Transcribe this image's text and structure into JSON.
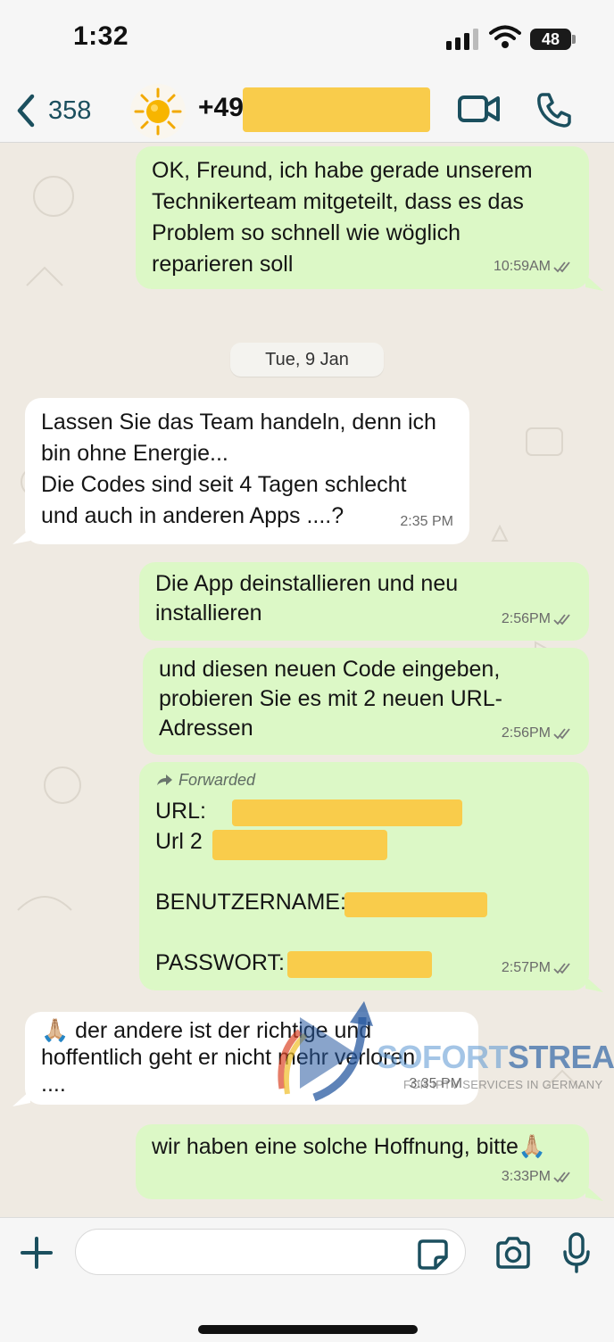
{
  "status_bar": {
    "time": "1:32",
    "battery": "48"
  },
  "header": {
    "back_count": "358",
    "contact_name": "+49"
  },
  "messages": [
    {
      "direction": "out",
      "text": "OK, Freund, ich habe gerade unserem\nTechnikerteam mitgeteilt, dass es das\nProblem so schnell wie wöglich\nreparieren soll",
      "time": "10:59AM"
    },
    {
      "direction": "in",
      "text": "Lassen Sie das Team handeln, denn ich\nbin ohne Energie...\nDie Codes sind seit 4 Tagen schlecht\nund auch in anderen Apps ....?",
      "time": "2:35 PM"
    },
    {
      "direction": "out",
      "text": "Die App deinstallieren und neu\ninstallieren",
      "time": "2:56PM"
    },
    {
      "direction": "out",
      "text": "und diesen neuen Code eingeben,\nprobieren Sie es mit 2 neuen URL-\nAdressen",
      "time": "2:56PM"
    },
    {
      "direction": "out",
      "forwarded_label": "Forwarded",
      "lines": {
        "url": "URL:",
        "url2": "Url 2",
        "user": "BENUTZERNAME:",
        "pass": "PASSWORT:"
      },
      "time": "2:57PM"
    },
    {
      "direction": "in",
      "text": "🙏🏼 der andere ist der richtige und\nhoffentlich geht er nicht mehr verloren\n....",
      "time": "3:35 PM"
    },
    {
      "direction": "out",
      "text": "wir haben eine solche Hoffnung, bitte🙏🏼",
      "time": "3:33PM"
    }
  ],
  "date_separator": "Tue, 9 Jan",
  "watermark": {
    "brand_a": "SOFORT",
    "brand_b": "STREAM",
    "tagline": "FOR IPTV SERVICES IN GERMANY"
  },
  "composer": {
    "input_value": ""
  },
  "colors": {
    "outgoing_bubble": "#dcf8c6",
    "incoming_bubble": "#ffffff",
    "chat_background": "#efeae2",
    "redaction": "#f9cc4b",
    "accent": "#1b4f5e"
  },
  "icons": [
    "back-chevron-icon",
    "sun-avatar-icon",
    "video-call-icon",
    "phone-icon",
    "read-ticks-icon",
    "forward-arrow-icon",
    "plus-icon",
    "sticker-icon",
    "camera-icon",
    "microphone-icon"
  ]
}
